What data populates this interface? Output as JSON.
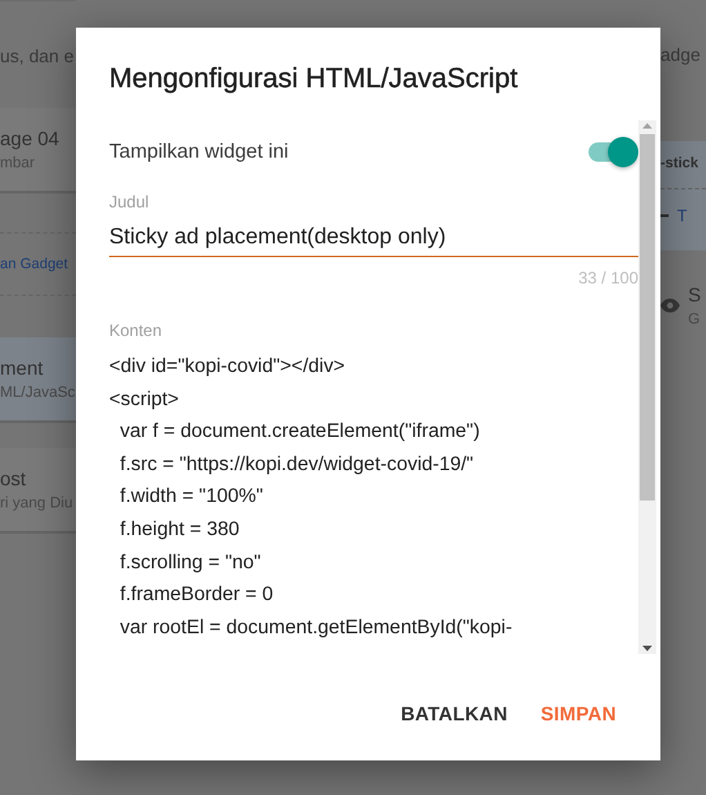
{
  "background": {
    "left": [
      {
        "kind": "line",
        "text": "us, dan e"
      },
      {
        "kind": "card",
        "title": "age 04",
        "subtitle": "mbar",
        "selected": false
      },
      {
        "kind": "link",
        "text": "an Gadget"
      },
      {
        "kind": "card",
        "title": "ment",
        "subtitle": "ML/JavaSc",
        "selected": true
      },
      {
        "kind": "card",
        "title": "ost",
        "subtitle": "ri yang Diu",
        "selected": false
      }
    ],
    "right": [
      {
        "kind": "line",
        "text": "adge"
      },
      {
        "kind": "header",
        "text": "-stick",
        "link": "T"
      },
      {
        "kind": "card",
        "title": "S",
        "subtitle": "G"
      }
    ]
  },
  "dialog": {
    "title": "Mengonfigurasi HTML/JavaScript",
    "widget_toggle": {
      "label": "Tampilkan widget ini",
      "on": true
    },
    "title_field": {
      "label": "Judul",
      "value": "Sticky ad placement(desktop only)",
      "counter": "33 / 100"
    },
    "content_field": {
      "label": "Konten",
      "lines": [
        "<div id=\"kopi-covid\"></div>",
        "<script>",
        "  var f = document.createElement(\"iframe\")",
        "  f.src = \"https://kopi.dev/widget-covid-19/\"",
        "  f.width = \"100%\"",
        "  f.height = 380",
        "  f.scrolling = \"no\"",
        "  f.frameBorder = 0",
        "  var rootEl = document.getElementById(\"kopi-"
      ]
    },
    "buttons": [
      {
        "label": "BATALKAN",
        "kind": "cancel"
      },
      {
        "label": "SIMPAN",
        "kind": "primary"
      }
    ]
  }
}
